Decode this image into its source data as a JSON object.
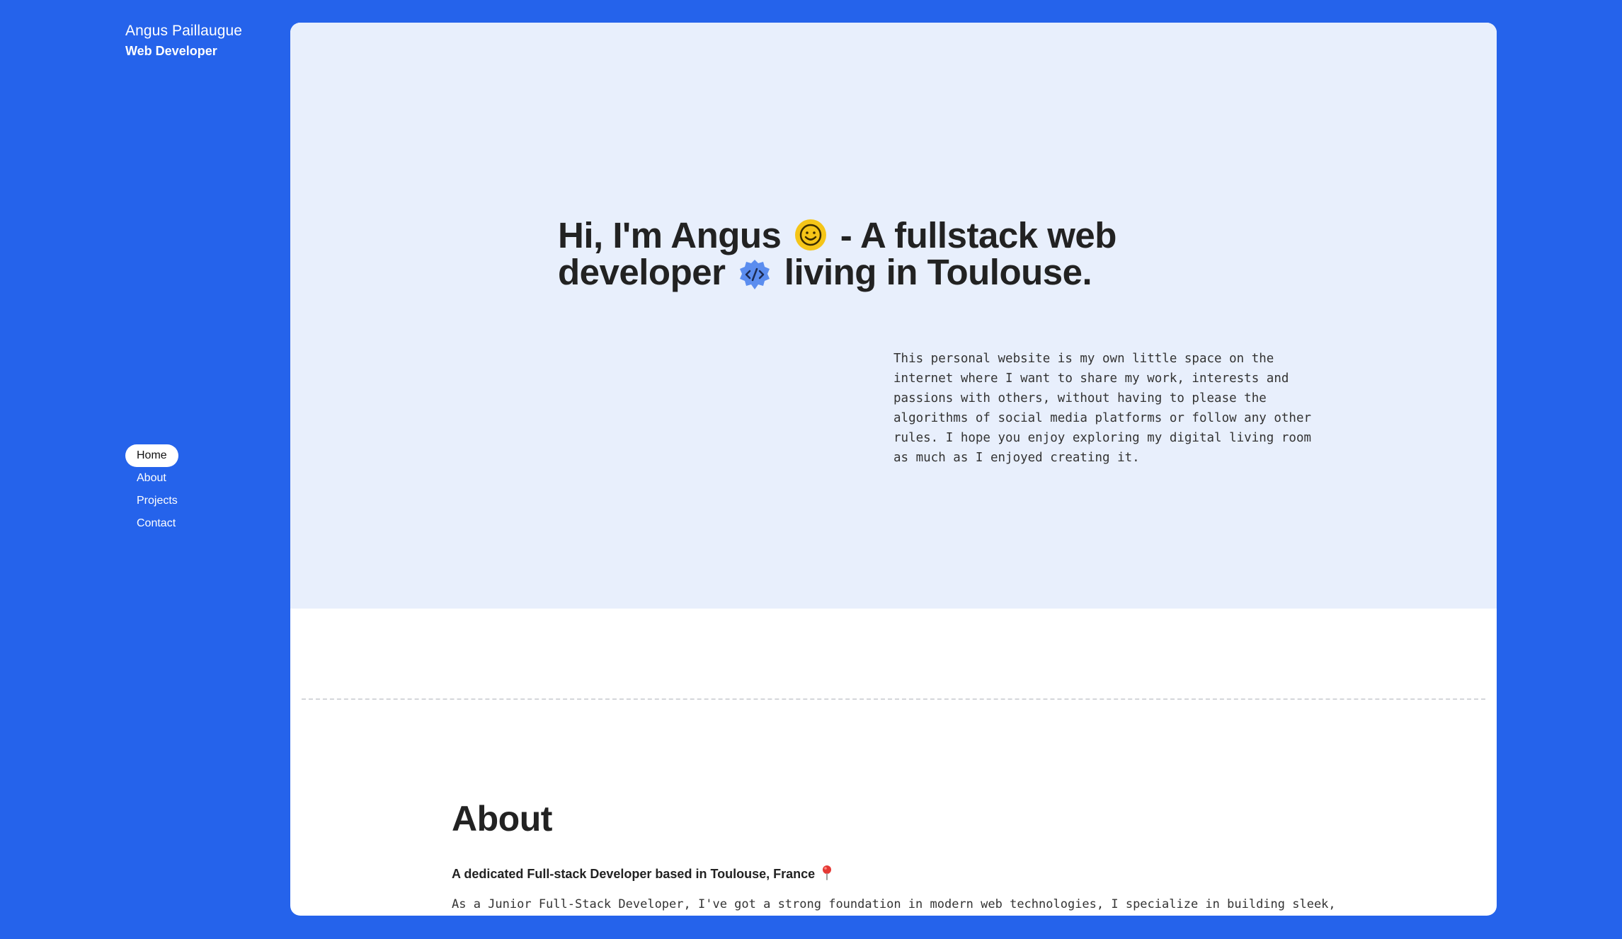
{
  "sidebar": {
    "name": "Angus Paillaugue",
    "role": "Web Developer",
    "nav": [
      {
        "label": "Home",
        "active": true
      },
      {
        "label": "About",
        "active": false
      },
      {
        "label": "Projects",
        "active": false
      },
      {
        "label": "Contact",
        "active": false
      }
    ]
  },
  "hero": {
    "title_part1": "Hi, I'm Angus",
    "title_part2": "- A fullstack web developer",
    "title_part3": "living in Toulouse.",
    "intro": "This personal website is my own little space on the internet where I want to share my work, interests and passions with others, without having to please the algorithms of social media platforms or follow any other rules. I hope you enjoy exploring my digital living room as much as I enjoyed creating it."
  },
  "about": {
    "heading": "About",
    "subheading": "A dedicated Full-stack Developer based in Toulouse, France",
    "body": "As a Junior Full-Stack Developer, I've got a strong foundation in modern web technologies, I specialize in building sleek,"
  },
  "icons": {
    "smile": "smiling-face-icon",
    "code": "code-badge-icon",
    "pin": "location-pin-icon"
  },
  "colors": {
    "background": "#2563eb",
    "hero_bg": "#e8effc",
    "text_dark": "#222222",
    "smile_yellow": "#f5c518",
    "code_blue": "#5b8def",
    "pin_red": "#e53935"
  }
}
